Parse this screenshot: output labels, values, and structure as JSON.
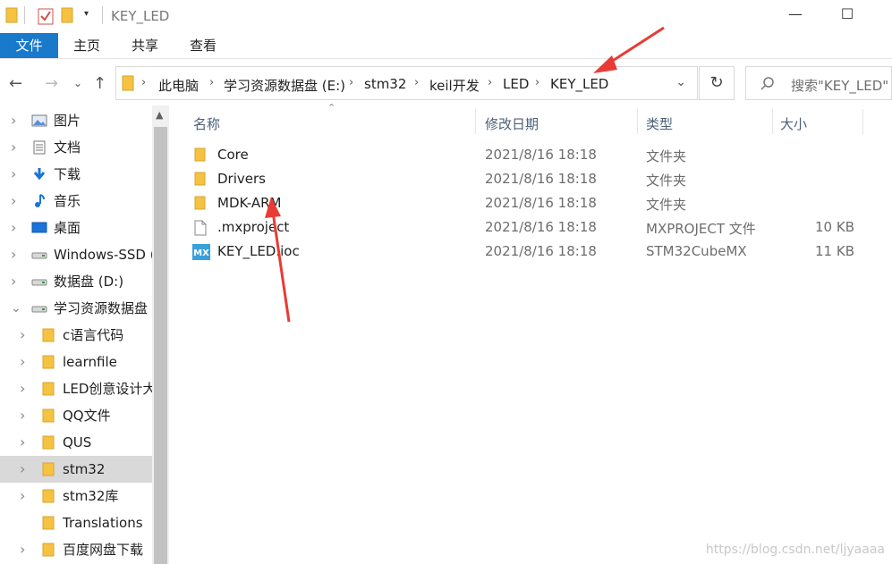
{
  "window": {
    "title": "KEY_LED",
    "minimize": "—",
    "maximize": "☐"
  },
  "ribbon": {
    "tabs": [
      "文件",
      "主页",
      "共享",
      "查看"
    ]
  },
  "address": {
    "crumbs": [
      "此电脑",
      "学习资源数据盘 (E:)",
      "stm32",
      "keil开发",
      "LED",
      "KEY_LED"
    ]
  },
  "search": {
    "placeholder": "搜索\"KEY_LED\""
  },
  "sidebar": {
    "items": [
      {
        "label": "图片",
        "icon": "pictures-icon"
      },
      {
        "label": "文档",
        "icon": "documents-icon"
      },
      {
        "label": "下载",
        "icon": "download-icon"
      },
      {
        "label": "音乐",
        "icon": "music-icon"
      },
      {
        "label": "桌面",
        "icon": "desktop-icon"
      },
      {
        "label": "Windows-SSD (",
        "icon": "drive-icon"
      },
      {
        "label": "数据盘 (D:)",
        "icon": "drive-icon"
      },
      {
        "label": "学习资源数据盘",
        "icon": "drive-icon"
      },
      {
        "label": "c语言代码",
        "icon": "folder-icon"
      },
      {
        "label": "learnfile",
        "icon": "folder-icon"
      },
      {
        "label": "LED创意设计大",
        "icon": "folder-icon"
      },
      {
        "label": "QQ文件",
        "icon": "folder-icon"
      },
      {
        "label": "QUS",
        "icon": "folder-icon"
      },
      {
        "label": "stm32",
        "icon": "folder-icon"
      },
      {
        "label": "stm32库",
        "icon": "folder-icon"
      },
      {
        "label": "Translations",
        "icon": "folder-icon"
      },
      {
        "label": "百度网盘下载",
        "icon": "folder-icon"
      }
    ]
  },
  "columns": {
    "name": "名称",
    "date": "修改日期",
    "type": "类型",
    "size": "大小"
  },
  "files": [
    {
      "name": "Core",
      "date": "2021/8/16 18:18",
      "type": "文件夹",
      "size": "",
      "icon": "folder-icon"
    },
    {
      "name": "Drivers",
      "date": "2021/8/16 18:18",
      "type": "文件夹",
      "size": "",
      "icon": "folder-icon"
    },
    {
      "name": "MDK-ARM",
      "date": "2021/8/16 18:18",
      "type": "文件夹",
      "size": "",
      "icon": "folder-icon"
    },
    {
      "name": ".mxproject",
      "date": "2021/8/16 18:18",
      "type": "MXPROJECT 文件",
      "size": "10 KB",
      "icon": "file-icon"
    },
    {
      "name": "KEY_LED.ioc",
      "date": "2021/8/16 18:18",
      "type": "STM32CubeMX",
      "size": "11 KB",
      "icon": "stm32cubemx-icon"
    }
  ],
  "mx_badge": "MX",
  "watermark": "https://blog.csdn.net/ljyaaaa",
  "colors": {
    "accent": "#1979ca",
    "folder": "#f5c242",
    "annotation_arrow": "#e83b35"
  }
}
